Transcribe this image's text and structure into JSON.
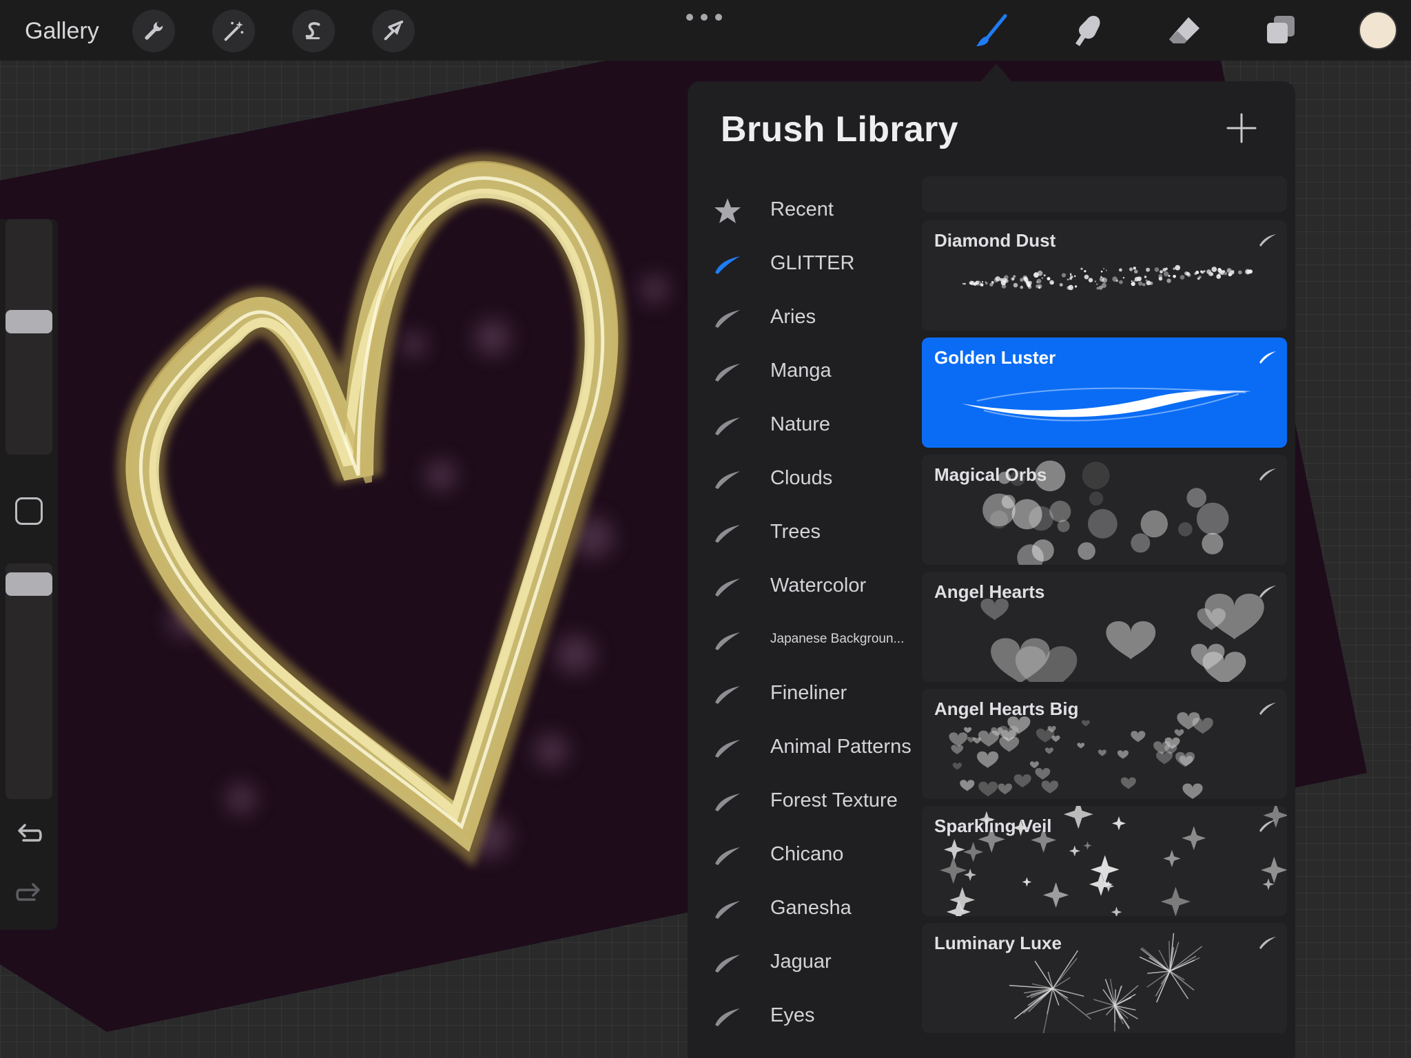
{
  "topbar": {
    "gallery_label": "Gallery",
    "tools_left": [
      {
        "name": "actions",
        "icon": "wrench-icon"
      },
      {
        "name": "adjustments",
        "icon": "magic-wand-icon"
      },
      {
        "name": "selection",
        "icon": "selection-s-icon"
      },
      {
        "name": "transform",
        "icon": "arrow-cursor-icon"
      }
    ],
    "tools_right": [
      {
        "name": "brush",
        "icon": "brush-icon",
        "active": true
      },
      {
        "name": "smudge",
        "icon": "smudge-finger-icon"
      },
      {
        "name": "eraser",
        "icon": "eraser-icon"
      },
      {
        "name": "layers",
        "icon": "layers-icon"
      }
    ],
    "current_color": "#f1e4d0",
    "accent_color": "#1f7cf5"
  },
  "sidebar": {
    "size_slider_level": 0.44,
    "opacity_slider_level": 0.9,
    "undo_icon": "undo-icon",
    "redo_icon": "redo-icon",
    "modify_icon": "square-modify-icon"
  },
  "brush_library": {
    "title": "Brush Library",
    "add_icon": "plus-icon",
    "sets": [
      {
        "label": "Recent",
        "icon": "star-icon",
        "active": false
      },
      {
        "label": "GLITTER",
        "icon": "brush-stroke-icon",
        "active": true
      },
      {
        "label": "Aries",
        "icon": "brush-stroke-icon",
        "active": false
      },
      {
        "label": "Manga",
        "icon": "brush-stroke-icon",
        "active": false
      },
      {
        "label": "Nature",
        "icon": "brush-stroke-icon",
        "active": false
      },
      {
        "label": "Clouds",
        "icon": "brush-stroke-icon",
        "active": false
      },
      {
        "label": "Trees",
        "icon": "brush-stroke-icon",
        "active": false
      },
      {
        "label": "Watercolor",
        "icon": "brush-stroke-icon",
        "active": false
      },
      {
        "label": "Japanese Backgroun...",
        "icon": "brush-stroke-icon",
        "active": false
      },
      {
        "label": "Fineliner",
        "icon": "brush-stroke-icon",
        "active": false
      },
      {
        "label": "Animal Patterns",
        "icon": "brush-stroke-icon",
        "active": false
      },
      {
        "label": "Forest Texture",
        "icon": "brush-stroke-icon",
        "active": false
      },
      {
        "label": "Chicano",
        "icon": "brush-stroke-icon",
        "active": false
      },
      {
        "label": "Ganesha",
        "icon": "brush-stroke-icon",
        "active": false
      },
      {
        "label": "Jaguar",
        "icon": "brush-stroke-icon",
        "active": false
      },
      {
        "label": "Eyes",
        "icon": "brush-stroke-icon",
        "active": false
      }
    ],
    "brushes": [
      {
        "name": "Diamond Dust",
        "selected": false,
        "preview": "sparkle-dust"
      },
      {
        "name": "Golden Luster",
        "selected": true,
        "preview": "smooth-stroke"
      },
      {
        "name": "Magical Orbs",
        "selected": false,
        "preview": "orbs"
      },
      {
        "name": "Angel Hearts",
        "selected": false,
        "preview": "hearts"
      },
      {
        "name": "Angel Hearts Big",
        "selected": false,
        "preview": "small-hearts"
      },
      {
        "name": "Sparkling Veil",
        "selected": false,
        "preview": "stars"
      },
      {
        "name": "Luminary Luxe",
        "selected": false,
        "preview": "starbursts"
      }
    ]
  }
}
